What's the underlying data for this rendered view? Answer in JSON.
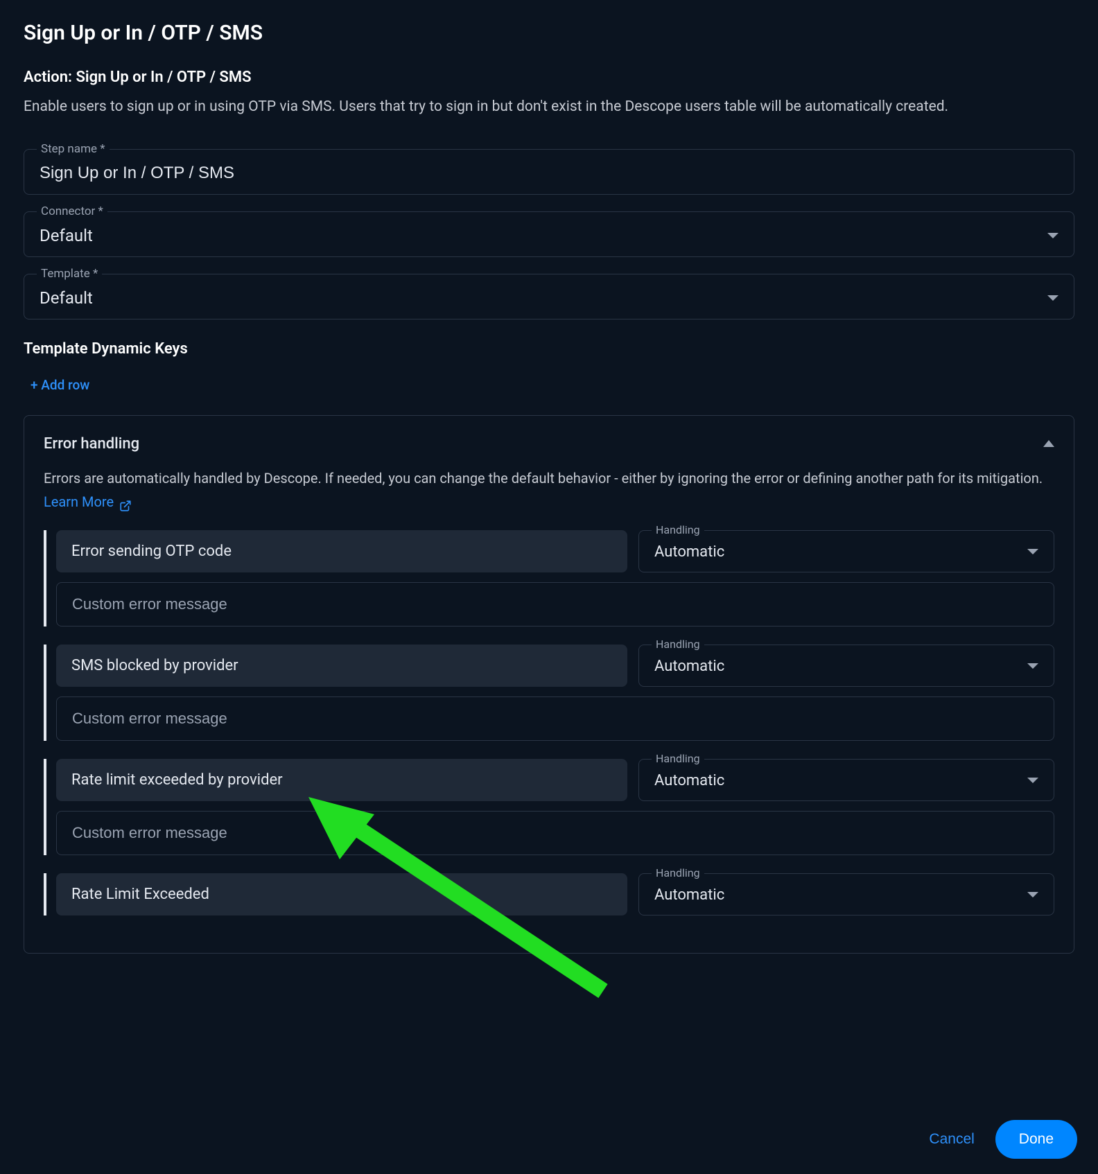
{
  "title": "Sign Up or In / OTP / SMS",
  "action_label": "Action: Sign Up or In / OTP / SMS",
  "action_description": "Enable users to sign up or in using OTP via SMS. Users that try to sign in but don't exist in the Descope users table will be automatically created.",
  "fields": {
    "step_name": {
      "label": "Step name *",
      "value": "Sign Up or In / OTP / SMS"
    },
    "connector": {
      "label": "Connector *",
      "value": "Default"
    },
    "template": {
      "label": "Template *",
      "value": "Default"
    }
  },
  "dynamic_keys": {
    "title": "Template Dynamic Keys",
    "add_row": "+ Add row"
  },
  "error_handling": {
    "title": "Error handling",
    "description": "Errors are automatically handled by Descope. If needed, you can change the default behavior - either by ignoring the error or defining another path for its mitigation.",
    "learn_more": "Learn More",
    "handling_label": "Handling",
    "custom_placeholder": "Custom error message",
    "items": [
      {
        "name": "Error sending OTP code",
        "handling": "Automatic"
      },
      {
        "name": "SMS blocked by provider",
        "handling": "Automatic"
      },
      {
        "name": "Rate limit exceeded by provider",
        "handling": "Automatic"
      },
      {
        "name": "Rate Limit Exceeded",
        "handling": "Automatic"
      }
    ]
  },
  "footer": {
    "cancel": "Cancel",
    "done": "Done"
  }
}
